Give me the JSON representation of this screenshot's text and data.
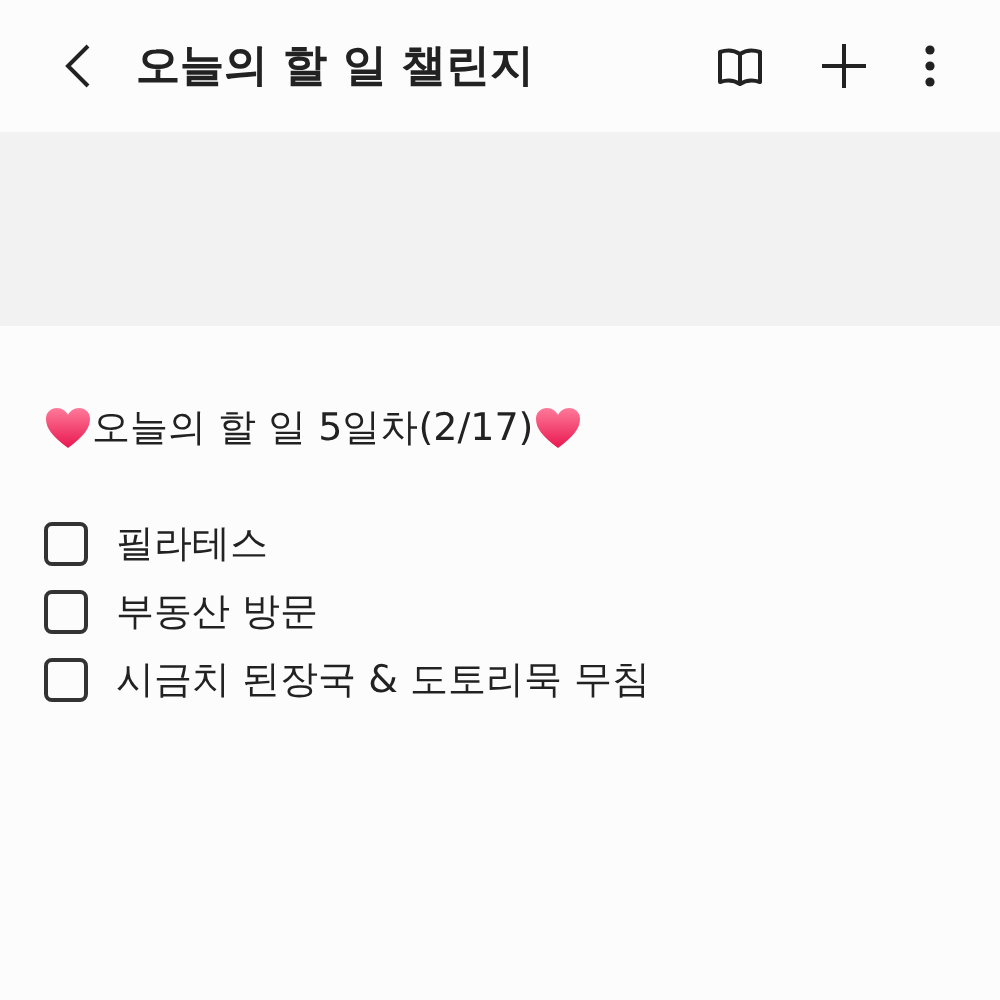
{
  "header": {
    "title": "오늘의 할 일 챌린지"
  },
  "note": {
    "heading": "오늘의 할 일 5일차(2/17)",
    "checklist": [
      {
        "text": "필라테스",
        "checked": false
      },
      {
        "text": "부동산 방문",
        "checked": false
      },
      {
        "text": "시금치 된장국 & 도토리묵 무침",
        "checked": false
      }
    ]
  }
}
